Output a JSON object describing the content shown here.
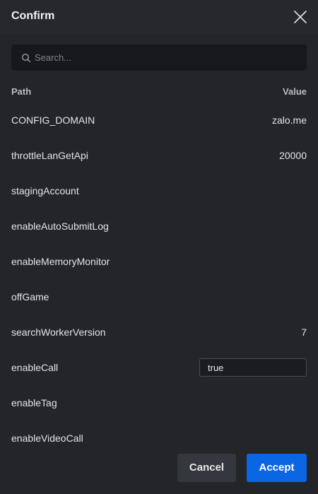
{
  "dialog": {
    "title": "Confirm",
    "close_icon": "close-icon"
  },
  "search": {
    "placeholder": "Search...",
    "value": "",
    "icon": "search-icon"
  },
  "table": {
    "headers": {
      "path": "Path",
      "value": "Value"
    },
    "rows": [
      {
        "path": "CONFIG_DOMAIN",
        "value": "zalo.me"
      },
      {
        "path": "throttleLanGetApi",
        "value": "20000"
      },
      {
        "path": "stagingAccount",
        "value": ""
      },
      {
        "path": "enableAutoSubmitLog",
        "value": ""
      },
      {
        "path": "enableMemoryMonitor",
        "value": ""
      },
      {
        "path": "offGame",
        "value": ""
      },
      {
        "path": "searchWorkerVersion",
        "value": "7"
      },
      {
        "path": "enableCall",
        "value": "true",
        "editing": true
      },
      {
        "path": "enableTag",
        "value": ""
      },
      {
        "path": "enableVideoCall",
        "value": ""
      }
    ]
  },
  "footer": {
    "cancel_label": "Cancel",
    "accept_label": "Accept"
  },
  "colors": {
    "background": "#232529",
    "accent": "#0b66e4",
    "secondary_button": "#34373d"
  }
}
